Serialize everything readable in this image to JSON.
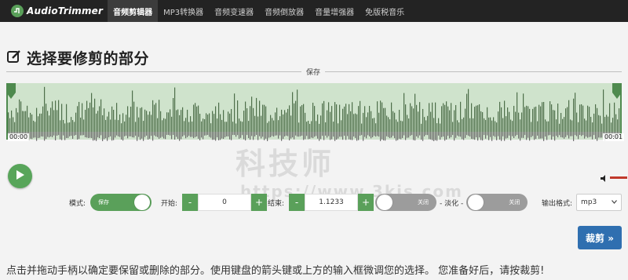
{
  "brand": {
    "name": "AudioTrimmer",
    "accent": "#5aa05a"
  },
  "nav": {
    "items": [
      {
        "label": "音频剪辑器",
        "active": true
      },
      {
        "label": "MP3转换器",
        "active": false
      },
      {
        "label": "音频变速器",
        "active": false
      },
      {
        "label": "音频倒放器",
        "active": false
      },
      {
        "label": "音量增强器",
        "active": false
      },
      {
        "label": "免版税音乐",
        "active": false
      }
    ]
  },
  "page": {
    "title": "选择要修剪的部分",
    "title_icon": "edit-square-icon"
  },
  "waveform": {
    "section_label": "保存",
    "start_time": "00:00",
    "end_time": "00:01",
    "fill_color": "#cfe3cc",
    "wave_color": "#4e6f4a"
  },
  "controls": {
    "mode_label": "模式:",
    "mode_toggle": "保存",
    "start_label": "开始:",
    "start_value": "0",
    "end_label": "结束:",
    "end_value": "1.1233",
    "fade_in_toggle": "关闭",
    "fade_label": "- 淡化 -",
    "fade_out_toggle": "关闭",
    "format_label": "输出格式:",
    "format_value": "mp3",
    "minus": "-",
    "plus": "+"
  },
  "actions": {
    "cut_button": "裁剪 »"
  },
  "instruction": "点击并拖动手柄以确定要保留或删除的部分。使用键盘的箭头键或上方的输入框微调您的选择。 您准备好后，请按裁剪!",
  "watermark": {
    "text": "科技师",
    "url": "https://www.3kjs.com"
  }
}
